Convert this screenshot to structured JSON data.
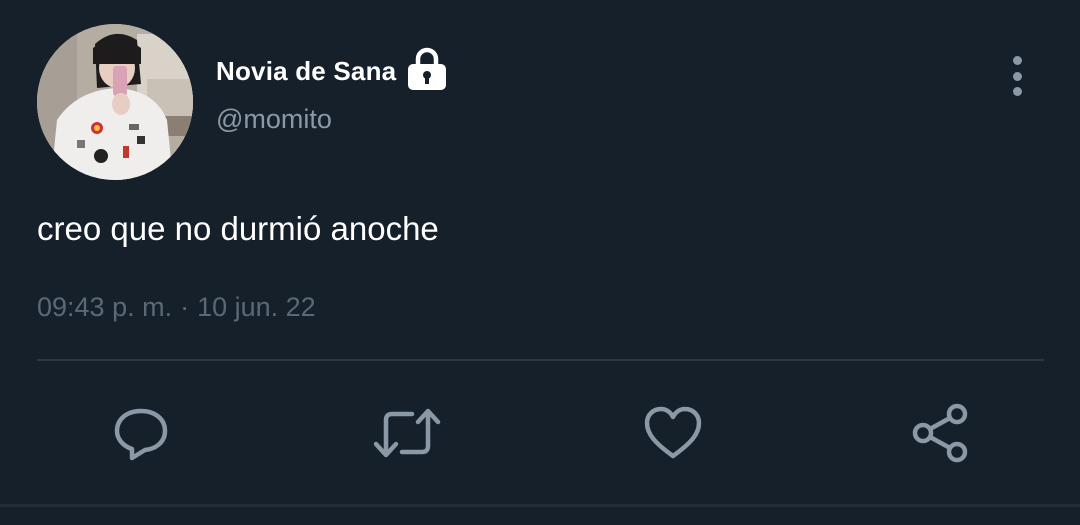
{
  "tweet": {
    "author": {
      "display_name": "Novia de Sana",
      "handle": "@momito",
      "protected_icon": "lock-icon",
      "avatar": "profile-photo"
    },
    "text": "creo que no durmió anoche",
    "time": "09:43 p. m.",
    "separator": "·",
    "date": "10 jun. 22"
  },
  "actions": [
    {
      "name": "reply",
      "icon": "reply-icon"
    },
    {
      "name": "retweet",
      "icon": "retweet-icon"
    },
    {
      "name": "like",
      "icon": "heart-icon"
    },
    {
      "name": "share",
      "icon": "share-icon"
    }
  ],
  "menu": {
    "icon": "more-vertical-icon"
  },
  "colors": {
    "background": "#16202b",
    "primary_text": "#ffffff",
    "secondary_text": "#8b98a5",
    "meta_text": "#5b6875",
    "icon": "#8b98a5",
    "divider": "#2b3744"
  }
}
